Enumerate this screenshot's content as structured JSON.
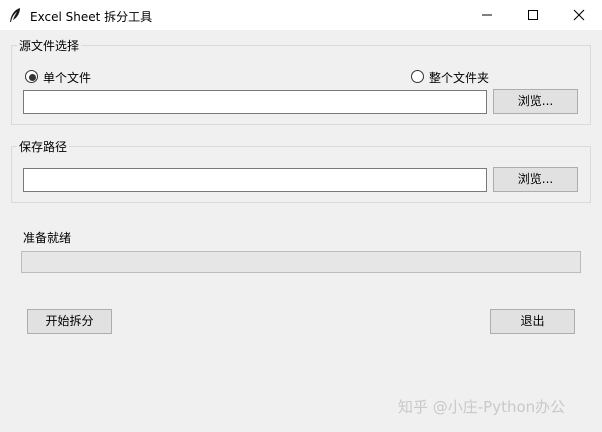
{
  "window": {
    "title": "Excel Sheet 拆分工具",
    "icon": "feather-icon",
    "controls": [
      "minimize-icon",
      "maximize-icon",
      "close-icon"
    ]
  },
  "source_group": {
    "label": "源文件选择",
    "radio_single": {
      "label": "单个文件",
      "selected": true
    },
    "radio_folder": {
      "label": "整个文件夹",
      "selected": false
    },
    "path_value": "",
    "browse_label": "浏览..."
  },
  "save_group": {
    "label": "保存路径",
    "path_value": "",
    "browse_label": "浏览..."
  },
  "status": {
    "text": "准备就绪"
  },
  "progress": {
    "fraction": 0
  },
  "actions": {
    "start_label": "开始拆分",
    "exit_label": "退出"
  },
  "watermark": "知乎 @小庄-Python办公"
}
